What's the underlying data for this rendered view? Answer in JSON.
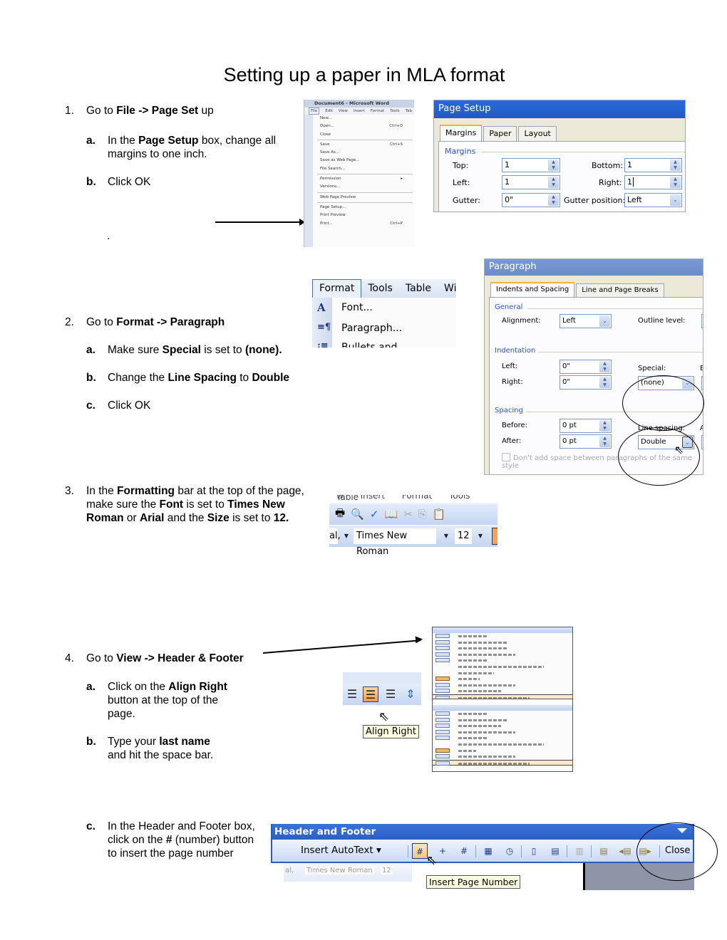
{
  "title": "Setting up a paper in MLA format",
  "steps": {
    "s1": {
      "num": "1.",
      "pre": "Go to ",
      "bold": "File -> Page Set",
      "post": " up",
      "a": {
        "label": "a.",
        "pre": "In the ",
        "bold": "Page Setup",
        "post": " box, change all margins to one inch."
      },
      "b": {
        "label": "b.",
        "text": "Click OK"
      },
      "dot": "."
    },
    "s2": {
      "num": "2.",
      "pre": "Go to ",
      "bold": "Format -> Paragraph",
      "a": {
        "label": "a.",
        "pre": "Make sure ",
        "bold1": "Special",
        "mid": " is set to ",
        "bold2": "(none)."
      },
      "b": {
        "label": "b.",
        "pre": "Change the ",
        "bold1": "Line Spacing",
        "mid": " to ",
        "bold2": "Double"
      },
      "c": {
        "label": "c.",
        "text": "Click OK"
      }
    },
    "s3": {
      "num": "3.",
      "t1": "In the ",
      "b1": "Formatting",
      "t2": " bar at the top of the page, make sure the ",
      "b2": "Font",
      "t3": " is set to ",
      "b3": "Times New Roman",
      "t4": " or ",
      "b4": "Arial",
      "t5": " and the ",
      "b5": "Size",
      "t6": " is set to ",
      "b6": "12."
    },
    "s4": {
      "num": "4.",
      "pre": "Go to ",
      "bold": "View -> Header & Footer",
      "a": {
        "label": "a.",
        "pre": "Click on the ",
        "bold": "Align Right",
        "post": " button at the top of the page."
      },
      "b": {
        "label": "b.",
        "pre": "Type your ",
        "bold": "last name",
        "post": " and hit the space bar."
      },
      "c": {
        "label": "c.",
        "pre": "In the Header and Footer box, click on the ",
        "bold": "#",
        "post": " (number) button to insert the page number"
      }
    }
  },
  "file_menu": {
    "window_title": "Document6 - Microsoft Word",
    "menubar": [
      "File",
      "Edit",
      "View",
      "Insert",
      "Format",
      "Tools",
      "Tab"
    ],
    "items": [
      {
        "label": "New...",
        "shortcut": ""
      },
      {
        "label": "Open...",
        "shortcut": "Ctrl+O"
      },
      {
        "label": "Close",
        "shortcut": ""
      },
      {
        "label": "Save",
        "shortcut": "Ctrl+S"
      },
      {
        "label": "Save As...",
        "shortcut": ""
      },
      {
        "label": "Save as Web Page...",
        "shortcut": ""
      },
      {
        "label": "File Search...",
        "shortcut": ""
      },
      {
        "label": "Permission",
        "shortcut": "▸"
      },
      {
        "label": "Versions...",
        "shortcut": ""
      },
      {
        "label": "Web Page Preview",
        "shortcut": ""
      },
      {
        "label": "Page Setup...",
        "shortcut": ""
      },
      {
        "label": "Print Preview",
        "shortcut": ""
      },
      {
        "label": "Print...",
        "shortcut": "Ctrl+P"
      }
    ]
  },
  "page_setup": {
    "title": "Page Setup",
    "tabs": [
      "Margins",
      "Paper",
      "Layout"
    ],
    "group": "Margins",
    "top_label": "Top:",
    "top_value": "1",
    "bottom_label": "Bottom:",
    "bottom_value": "1",
    "left_label": "Left:",
    "left_value": "1",
    "right_label": "Right:",
    "right_value": "1",
    "gutter_label": "Gutter:",
    "gutter_value": "0\"",
    "gutter_pos_label": "Gutter position:",
    "gutter_pos_value": "Left"
  },
  "format_menu": {
    "menubar": [
      "Format",
      "Tools",
      "Table",
      "Wind"
    ],
    "items": [
      "Font...",
      "Paragraph...",
      "Bullets and Numbering..."
    ]
  },
  "paragraph": {
    "title": "Paragraph",
    "tabs": [
      "Indents and Spacing",
      "Line and Page Breaks"
    ],
    "general": "General",
    "alignment_label": "Alignment:",
    "alignment_value": "Left",
    "outline_label": "Outline level:",
    "indentation": "Indentation",
    "left_label": "Left:",
    "left_value": "0\"",
    "right_label": "Right:",
    "right_value": "0\"",
    "special_label": "Special:",
    "special_value": "(none)",
    "by_label": "B",
    "spacing": "Spacing",
    "before_label": "Before:",
    "before_value": "0 pt",
    "after_label": "After:",
    "after_value": "0 pt",
    "line_spacing_label": "Line spacing:",
    "line_spacing_value": "Double",
    "at_label": "A",
    "checkbox_label": "Don't add space between paragraphs of the same style"
  },
  "formatting_bar": {
    "menu": "w   Insert   Format   Tools   Table",
    "style_value": "al,",
    "font_value": "Times New Roman",
    "size_value": "12"
  },
  "align_tooltip": "Align Right",
  "header_footer": {
    "title": "Header and Footer",
    "insert_autotext": "Insert AutoText ▾",
    "close": "Close",
    "font_value": "Times New Roman",
    "size_value": "12",
    "style_value": "al,",
    "tooltip": "Insert Page Number"
  }
}
